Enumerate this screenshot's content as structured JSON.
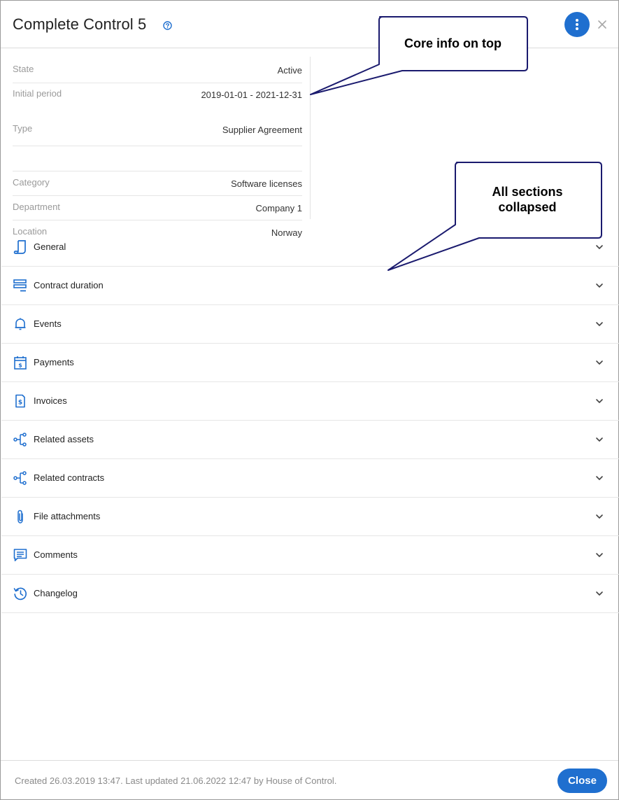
{
  "dialog": {
    "title": "Complete Control 5",
    "icons": {
      "help": "help-circle-icon",
      "menu": "vertical-dots-icon",
      "close": "close-icon"
    }
  },
  "core_info": [
    {
      "label": "State",
      "value": "Active"
    },
    {
      "label": "Initial period",
      "value": "2019-01-01 - 2021-12-31"
    },
    {
      "label": "Type",
      "value": "Supplier Agreement"
    },
    {
      "label": "Category",
      "value": "Software licenses"
    },
    {
      "label": "Department",
      "value": "Company 1"
    },
    {
      "label": "Location",
      "value": "Norway"
    }
  ],
  "sections": [
    {
      "label": "General",
      "icon": "scroll-icon"
    },
    {
      "label": "Contract duration",
      "icon": "timeline-icon"
    },
    {
      "label": "Events",
      "icon": "bell-icon"
    },
    {
      "label": "Payments",
      "icon": "calendar-dollar-icon"
    },
    {
      "label": "Invoices",
      "icon": "invoice-dollar-icon"
    },
    {
      "label": "Related assets",
      "icon": "relations-icon"
    },
    {
      "label": "Related contracts",
      "icon": "relations-icon"
    },
    {
      "label": "File attachments",
      "icon": "paperclip-icon"
    },
    {
      "label": "Comments",
      "icon": "comment-icon"
    },
    {
      "label": "Changelog",
      "icon": "history-icon"
    }
  ],
  "footer": {
    "meta_text": "Created 26.03.2019 13:47. Last updated 21.06.2022 12:47 by House of Control.",
    "close_label": "Close"
  },
  "callouts": {
    "top": "Core info on top",
    "sections_line1": "All sections",
    "sections_line2": "collapsed"
  },
  "colors": {
    "accent": "#1f6fcf",
    "callout_border": "#1a1a6e"
  }
}
